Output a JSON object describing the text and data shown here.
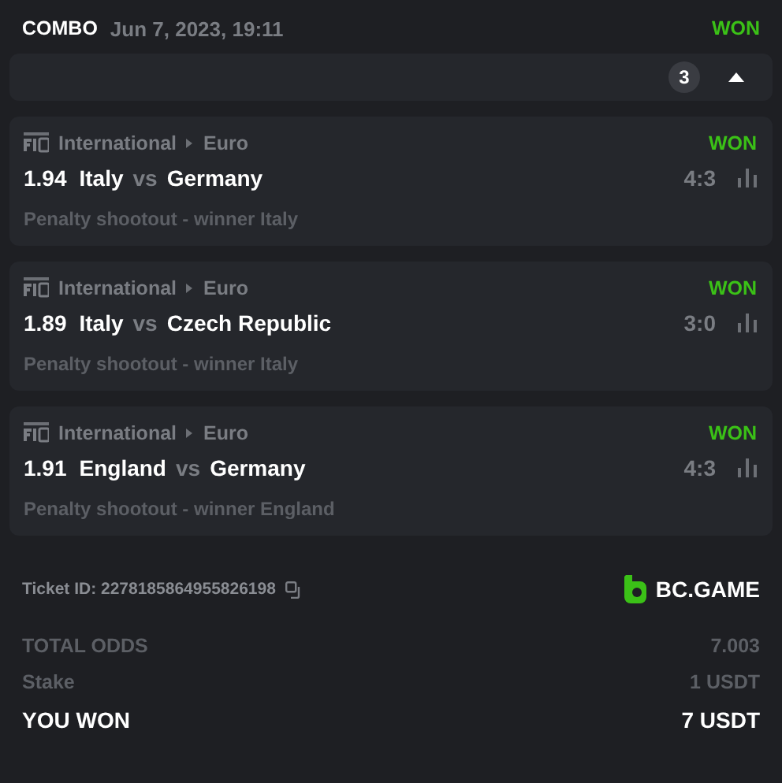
{
  "header": {
    "type": "COMBO",
    "date": "Jun 7, 2023, 19:11",
    "status": "WON"
  },
  "legs_bar": {
    "count": "3",
    "expanded": true
  },
  "matches": [
    {
      "category": "International",
      "league": "Euro",
      "status": "WON",
      "odds": "1.94",
      "home": "Italy",
      "vs": "vs",
      "away": "Germany",
      "score": "4:3",
      "market": "Penalty shootout - winner Italy"
    },
    {
      "category": "International",
      "league": "Euro",
      "status": "WON",
      "odds": "1.89",
      "home": "Italy",
      "vs": "vs",
      "away": "Czech Republic",
      "score": "3:0",
      "market": "Penalty shootout - winner Italy"
    },
    {
      "category": "International",
      "league": "Euro",
      "status": "WON",
      "odds": "1.91",
      "home": "England",
      "vs": "vs",
      "away": "Germany",
      "score": "4:3",
      "market": "Penalty shootout - winner England"
    }
  ],
  "ticket": {
    "label": "Ticket ID: 2278185864955826198",
    "brand": "BC.GAME"
  },
  "totals": [
    {
      "kind": "plain",
      "label": "TOTAL ODDS",
      "value": "7.003"
    },
    {
      "kind": "plain",
      "label": "Stake",
      "value": "1 USDT"
    },
    {
      "kind": "result",
      "label": "YOU WON",
      "value": "7 USDT"
    }
  ]
}
